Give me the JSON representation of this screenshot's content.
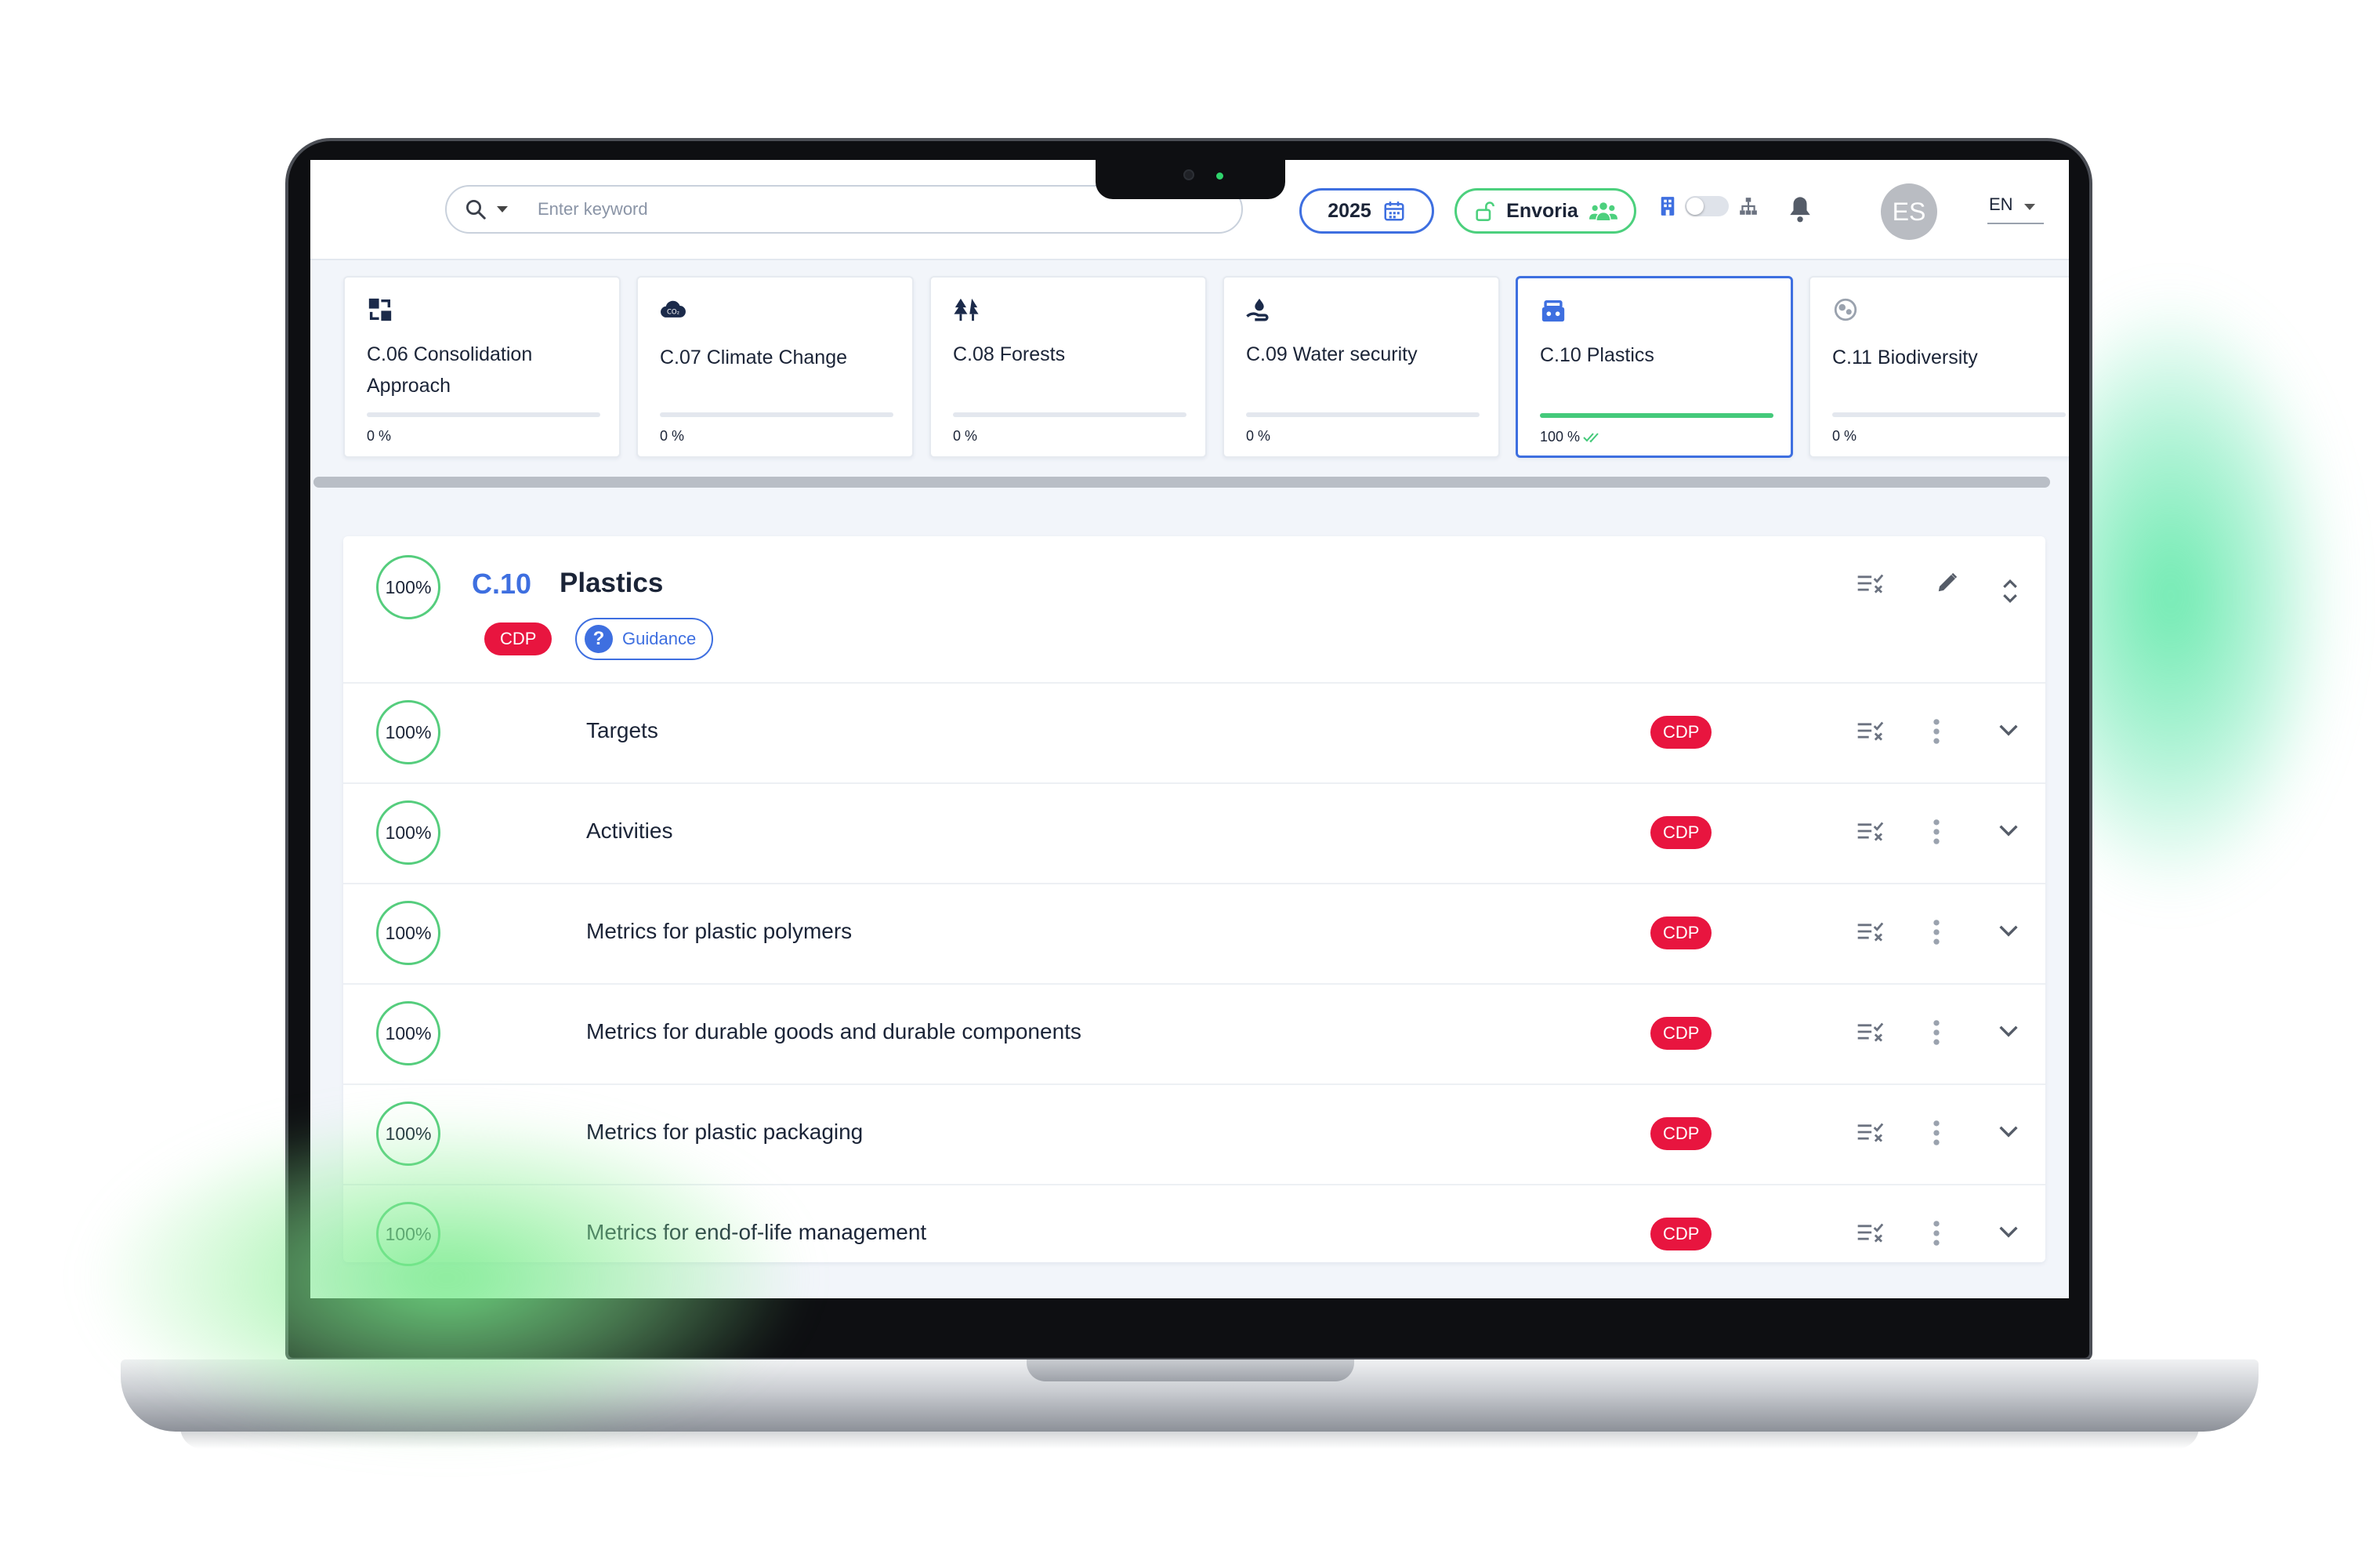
{
  "topbar": {
    "search_placeholder": "Enter keyword",
    "year": "2025",
    "organization": "Envoria",
    "avatar_initials": "ES",
    "language": "EN"
  },
  "cards": [
    {
      "label": "C.06 Consolidation Approach",
      "progress_text": "0 %",
      "progress": 0,
      "icon": "consolidation-icon"
    },
    {
      "label": "C.07 Climate Change",
      "progress_text": "0 %",
      "progress": 0,
      "icon": "co2-cloud-icon"
    },
    {
      "label": "C.08 Forests",
      "progress_text": "0 %",
      "progress": 0,
      "icon": "forest-icon"
    },
    {
      "label": "C.09 Water security",
      "progress_text": "0 %",
      "progress": 0,
      "icon": "water-hand-icon"
    },
    {
      "label": "C.10 Plastics",
      "progress_text": "100 %",
      "progress": 100,
      "icon": "plastics-basket-icon",
      "selected": true
    },
    {
      "label": "C.11 Biodiversity",
      "progress_text": "0 %",
      "progress": 0,
      "icon": "biodiversity-icon"
    }
  ],
  "section": {
    "progress": "100%",
    "code": "C.10",
    "title": "Plastics",
    "badge": "CDP",
    "guidance_label": "Guidance"
  },
  "rows": [
    {
      "progress": "100%",
      "name": "Targets",
      "badge": "CDP"
    },
    {
      "progress": "100%",
      "name": "Activities",
      "badge": "CDP"
    },
    {
      "progress": "100%",
      "name": "Metrics for plastic polymers",
      "badge": "CDP"
    },
    {
      "progress": "100%",
      "name": "Metrics for durable goods and durable components",
      "badge": "CDP"
    },
    {
      "progress": "100%",
      "name": "Metrics for plastic packaging",
      "badge": "CDP"
    },
    {
      "progress": "100%",
      "name": "Metrics for end-of-life management",
      "badge": "CDP"
    }
  ],
  "colors": {
    "accent_blue": "#3e6fe0",
    "success_green": "#44c97a",
    "cdp_red": "#e8153f",
    "text_dark": "#1b2437"
  }
}
